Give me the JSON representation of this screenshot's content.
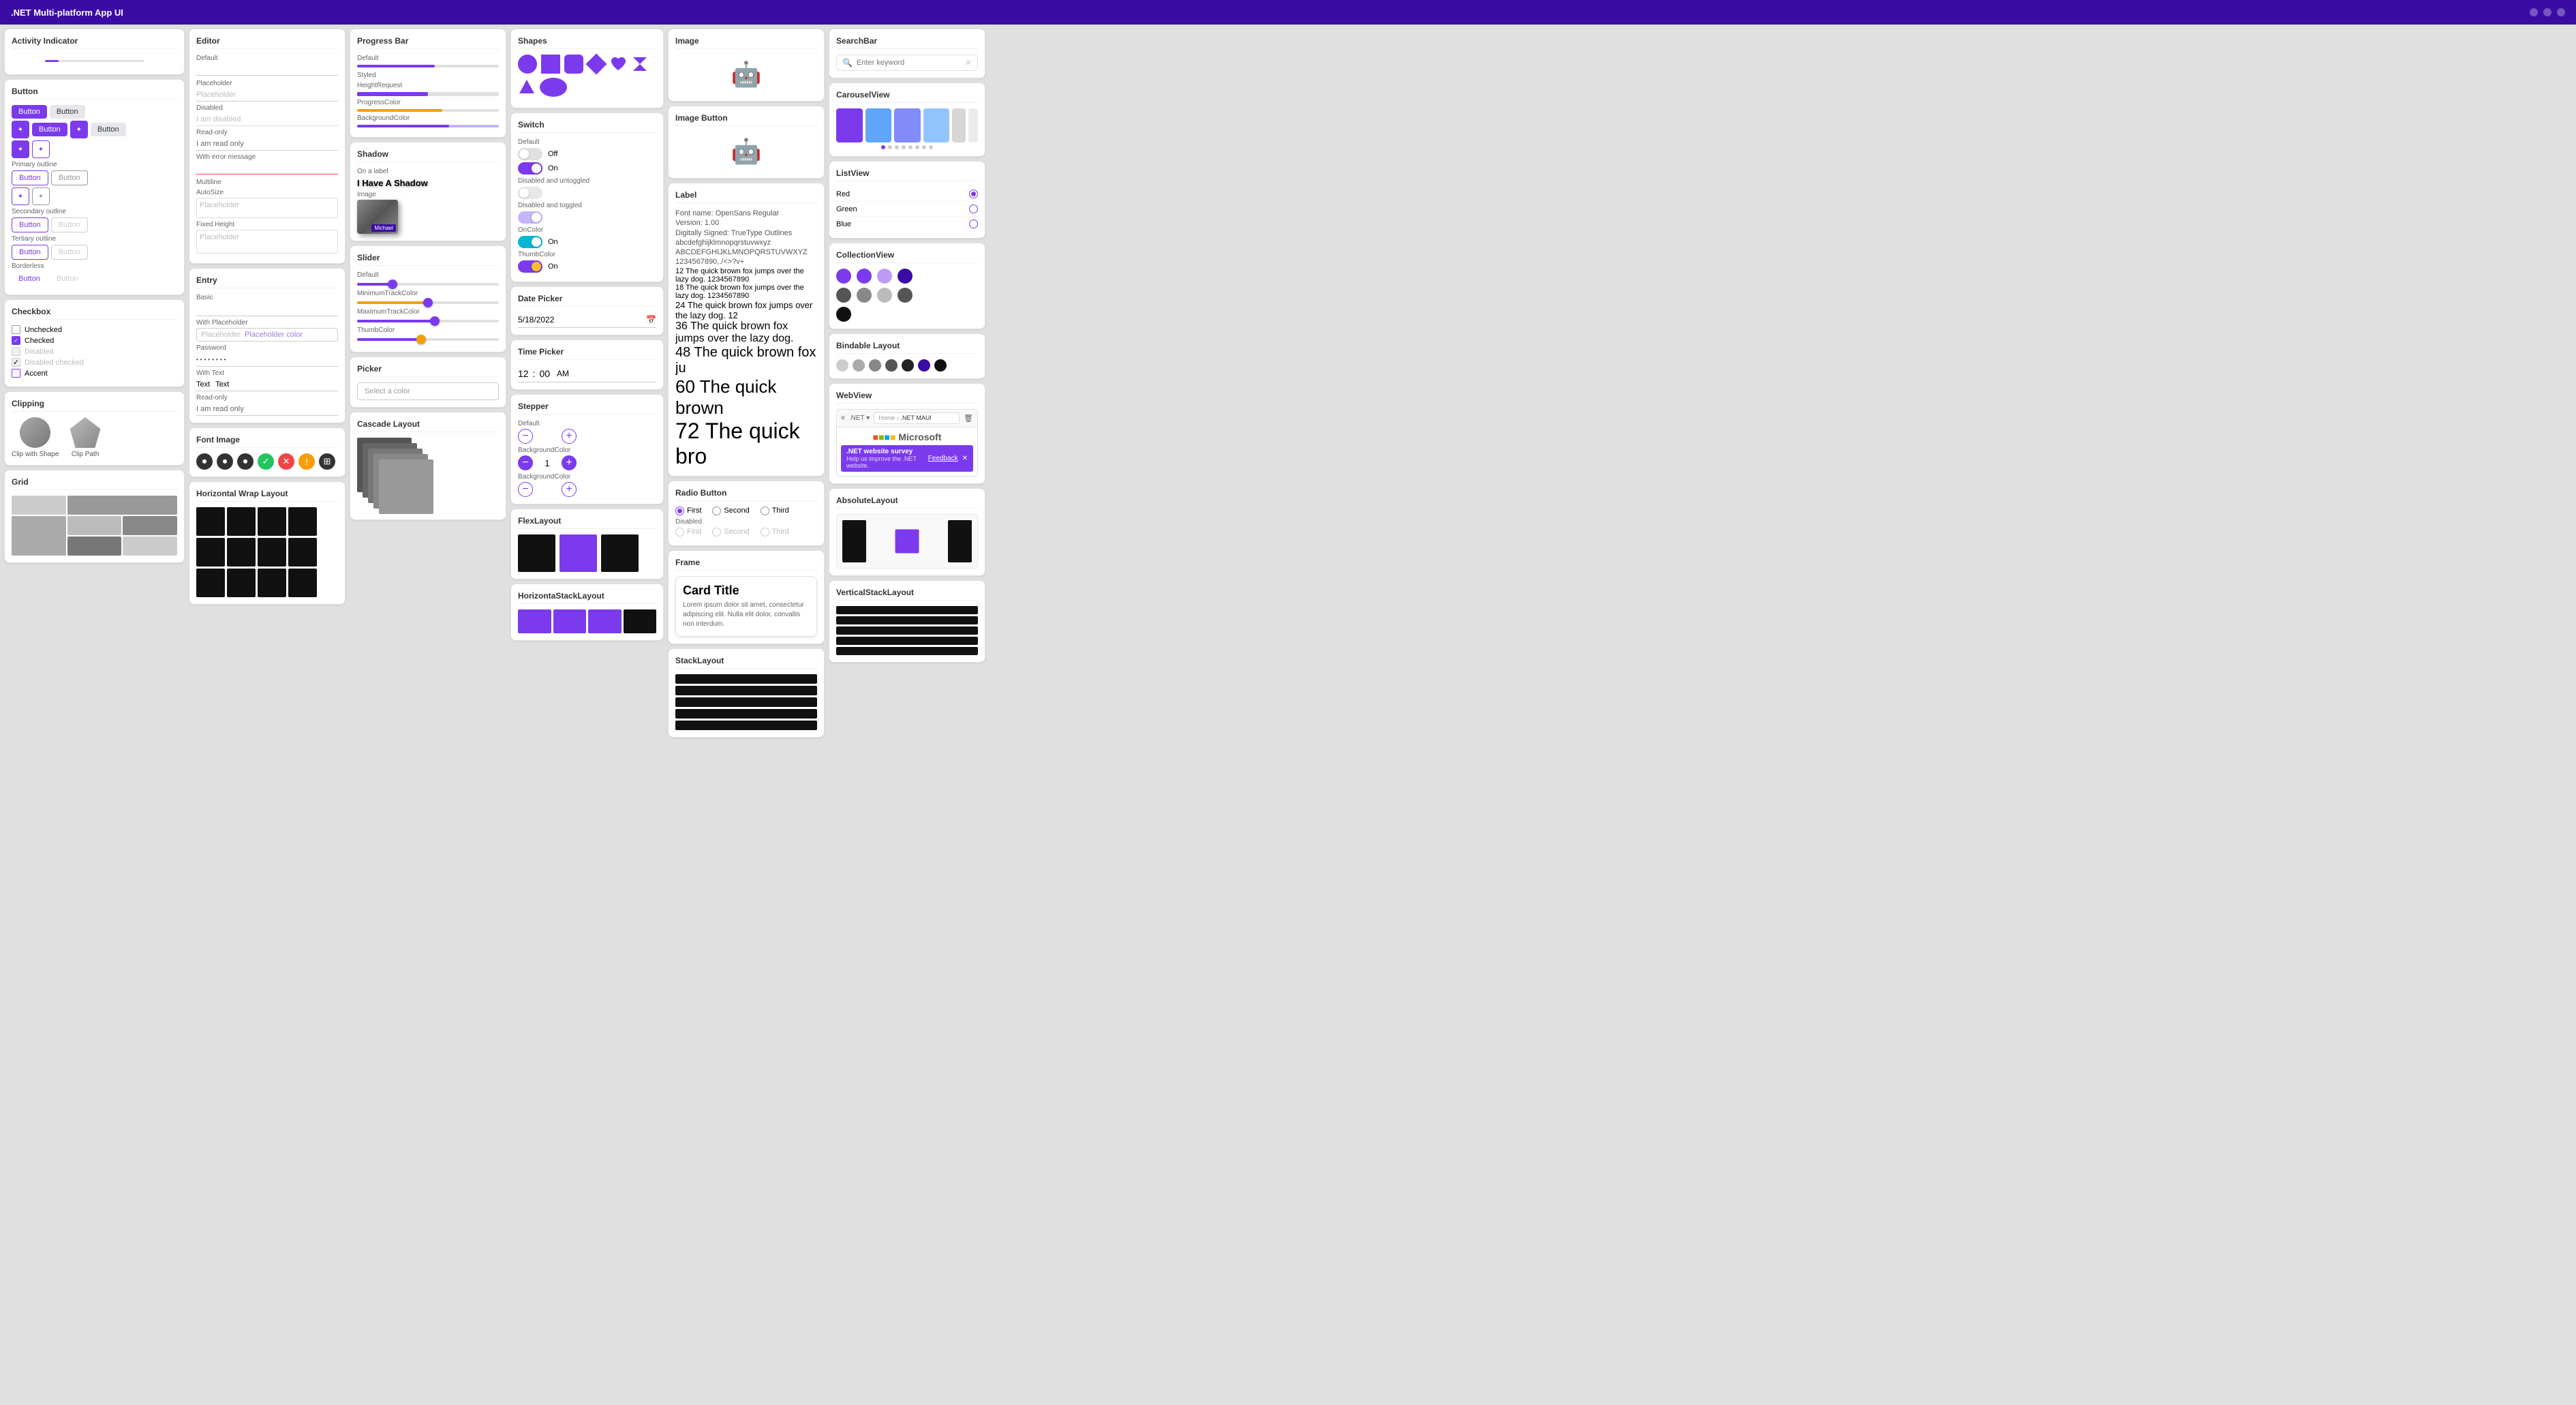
{
  "app": {
    "title": ".NET Multi-platform App UI"
  },
  "sections": {
    "activity_indicator": {
      "label": "Activity Indicator"
    },
    "button": {
      "label": "Button"
    },
    "checkbox": {
      "label": "Checkbox"
    },
    "clipping": {
      "label": "Clipping"
    },
    "grid": {
      "label": "Grid"
    },
    "editor": {
      "label": "Editor"
    },
    "entry": {
      "label": "Entry"
    },
    "font_image": {
      "label": "Font Image"
    },
    "horizontal_wrap_layout": {
      "label": "Horizontal Wrap Layout"
    },
    "progress_bar": {
      "label": "Progress Bar"
    },
    "shadow": {
      "label": "Shadow"
    },
    "slider": {
      "label": "Slider"
    },
    "picker": {
      "label": "Picker"
    },
    "cascade_layout": {
      "label": "Cascade Layout"
    },
    "shapes": {
      "label": "Shapes"
    },
    "switch": {
      "label": "Switch"
    },
    "date_picker": {
      "label": "Date Picker"
    },
    "time_picker": {
      "label": "Time Picker"
    },
    "stepper": {
      "label": "Stepper"
    },
    "flex_layout": {
      "label": "FlexLayout"
    },
    "horizontal_stack_layout": {
      "label": "HorizontaStackLayout"
    },
    "image": {
      "label": "Image"
    },
    "image_button": {
      "label": "Image Button"
    },
    "label": {
      "label": "Label"
    },
    "radio_button": {
      "label": "Radio Button"
    },
    "frame": {
      "label": "Frame"
    },
    "stack_layout": {
      "label": "StackLayout"
    },
    "search_bar": {
      "label": "SearchBar"
    },
    "carousel_view": {
      "label": "CarouselView"
    },
    "list_view": {
      "label": "ListView"
    },
    "collection_view": {
      "label": "CollectionView"
    },
    "bindable_layout": {
      "label": "Bindable Layout"
    },
    "web_view": {
      "label": "WebView"
    },
    "absolute_layout": {
      "label": "AbsoluteLayout"
    },
    "vertical_stack_layout": {
      "label": "VerticalStackLayout"
    }
  },
  "button": {
    "btn1": "Button",
    "btn2": "Button",
    "btn3": "Button",
    "btn4": "Button",
    "primary_outline": "Primary outline",
    "btn5": "Button",
    "btn6": "Button",
    "secondary_outline": "Secondary outline",
    "btn7": "Button",
    "btn8": "Button",
    "tertiary_outline": "Tertiary outline",
    "btn9": "Button",
    "btn10": "Button",
    "borderless": "Borderless",
    "btn11": "Button",
    "btn12": "Button"
  },
  "checkbox": {
    "unchecked": "Unchecked",
    "checked": "Checked",
    "disabled": "Disabled",
    "disabled_checked": "Disabled checked",
    "accent": "Accent"
  },
  "clipping": {
    "clip_with_shape": "Clip with Shape",
    "clip_path": "Clip Path"
  },
  "editor": {
    "default_label": "Default",
    "placeholder_label": "Placeholder",
    "placeholder_value": "Placeholder",
    "disabled_label": "Disabled",
    "disabled_value": "I am disabled",
    "readonly_label": "Read-only",
    "readonly_value": "I am read only",
    "error_label": "With error message",
    "multiline_label": "Multiline",
    "autosize_label": "AutoSize",
    "fixed_height_label": "Fixed Height",
    "placeholder_hint": "Placeholder"
  },
  "entry": {
    "basic_label": "Basic",
    "with_placeholder_label": "With Placeholder",
    "placeholder_hint": "Placeholder",
    "placeholder_color": "Placeholder color",
    "password_label": "Password",
    "with_text_label": "With Text",
    "text_value": "Text",
    "text_value2": "Text",
    "readonly_label": "Read-only",
    "readonly_value": "I am read only"
  },
  "progress_bar": {
    "default_label": "Default",
    "styled_label": "Styled",
    "height_request": "HeightRequest",
    "progress_color": "ProgressColor",
    "background_color": "BackgroundColor"
  },
  "shadow": {
    "on_label": "On a label",
    "i_have_shadow": "I Have A Shadow",
    "image_label": "Image"
  },
  "slider": {
    "default_label": "Default",
    "min_track": "MinimumTrackColor",
    "max_track": "MaximumTrackColor",
    "thumb_color": "ThumbColor"
  },
  "picker": {
    "select_label": "Select a color"
  },
  "shapes": {
    "label": "Shapes"
  },
  "switch": {
    "default_label": "Default",
    "off_label": "Off",
    "on_label": "On",
    "disabled_untoggled": "Disabled and untoggled",
    "disabled_toggled": "Disabled and toggled",
    "on_color": "OnColor",
    "thumb_color": "ThumbColor"
  },
  "date_picker": {
    "value": "5/18/2022"
  },
  "time_picker": {
    "hours": "12",
    "minutes": "00",
    "ampm": "AM"
  },
  "stepper": {
    "default_label": "Default",
    "bg_color_label": "BackgroundColor",
    "bg_color_label2": "BackgroundColor"
  },
  "font_image": {
    "label": "Font Image"
  },
  "label_section": {
    "font_name": "Font name: OpenSans Regular",
    "version": "Version: 1.00",
    "digitally_signed": "Digitally Signed: TrueType Outlines",
    "chars": "abcdefghijklmnopqrstuvwxyz ABCDEFGHIJKLMNOPQRSTUVWXYZ",
    "numbers": "1234567890,./<>?v+",
    "line12": "12 The quick brown fox jumps over the lazy dog. 1234567890",
    "line18": "18 The quick brown fox jumps over the lazy dog. 1234567890",
    "line24": "24 The quick brown fox jumps over the lazy dog. 12",
    "line36": "36 The quick brown fox jumps over the lazy dog.",
    "line48": "48 The quick brown fox ju",
    "line60": "60 The quick brown",
    "line72": "72 The quick bro"
  },
  "radio_button": {
    "first": "First",
    "second": "Second",
    "third": "Third",
    "disabled": "Disabled"
  },
  "frame": {
    "card_title": "Card Title",
    "card_body": "Lorem ipsum dolor sit amet, consectetur adipiscing elit. Nulla elit dolor, convallis non interdum."
  },
  "search_bar": {
    "placeholder": "Enter keyword",
    "search_icon": "🔍"
  },
  "list_view": {
    "items": [
      "Red",
      "Green",
      "Blue"
    ]
  },
  "web_view": {
    "url": ".NET MAUI",
    "home": "Home",
    "dot_net": ".NET ▾",
    "ms_label": "Microsoft",
    "survey_title": ".NET website survey",
    "survey_text": "Help us improve the .NET website.",
    "feedback": "Feedback"
  }
}
